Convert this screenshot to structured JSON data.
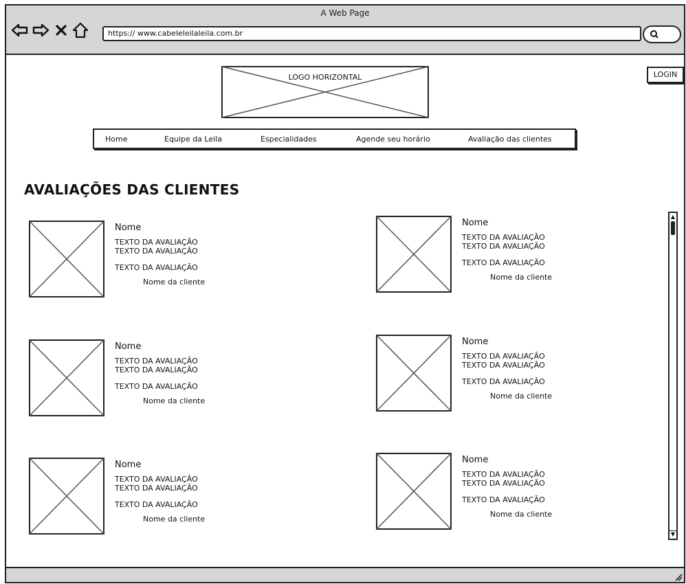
{
  "window": {
    "title": "A Web Page",
    "url": "https://  www.cabeleleilaleila.com.br"
  },
  "toolbar": {
    "icons": [
      "back-arrow-icon",
      "forward-arrow-icon",
      "close-icon",
      "home-icon",
      "search-icon"
    ]
  },
  "header": {
    "logo_label": "LOGO HORIZONTAL",
    "login_label": "LOGIN"
  },
  "menu": {
    "items": [
      "Home",
      "Equipe da Leila",
      "Especialidades",
      "Agende seu horário",
      "Avaliação das clientes"
    ]
  },
  "section": {
    "title": "AVALIAÇÕES DAS CLIENTES"
  },
  "reviews": [
    {
      "name": "Nome",
      "text1": "TEXTO DA AVALIAÇÃO",
      "text2": "TEXTO DA AVALIAÇÃO",
      "text3": "TEXTO DA AVALIAÇÃO",
      "client": "Nome da cliente"
    },
    {
      "name": "Nome",
      "text1": "TEXTO DA AVALIAÇÃO",
      "text2": "TEXTO DA AVALIAÇÃO",
      "text3": "TEXTO DA AVALIAÇÃO",
      "client": "Nome da cliente"
    },
    {
      "name": "Nome",
      "text1": "TEXTO DA AVALIAÇÃO",
      "text2": "TEXTO DA AVALIAÇÃO",
      "text3": "TEXTO DA AVALIAÇÃO",
      "client": "Nome da cliente"
    },
    {
      "name": "Nome",
      "text1": "TEXTO DA AVALIAÇÃO",
      "text2": "TEXTO DA AVALIAÇÃO",
      "text3": "TEXTO DA AVALIAÇÃO",
      "client": "Nome da cliente"
    },
    {
      "name": "Nome",
      "text1": "TEXTO DA AVALIAÇÃO",
      "text2": "TEXTO DA AVALIAÇÃO",
      "text3": "TEXTO DA AVALIAÇÃO",
      "client": "Nome da cliente"
    },
    {
      "name": "Nome",
      "text1": "TEXTO DA AVALIAÇÃO",
      "text2": "TEXTO DA AVALIAÇÃO",
      "text3": "TEXTO DA AVALIAÇÃO",
      "client": "Nome da cliente"
    }
  ]
}
